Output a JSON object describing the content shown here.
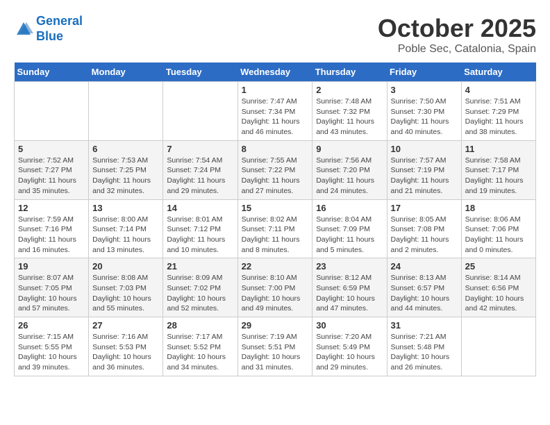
{
  "header": {
    "logo_line1": "General",
    "logo_line2": "Blue",
    "month": "October 2025",
    "location": "Poble Sec, Catalonia, Spain"
  },
  "weekdays": [
    "Sunday",
    "Monday",
    "Tuesday",
    "Wednesday",
    "Thursday",
    "Friday",
    "Saturday"
  ],
  "weeks": [
    [
      {
        "day": "",
        "info": ""
      },
      {
        "day": "",
        "info": ""
      },
      {
        "day": "",
        "info": ""
      },
      {
        "day": "1",
        "info": "Sunrise: 7:47 AM\nSunset: 7:34 PM\nDaylight: 11 hours and 46 minutes."
      },
      {
        "day": "2",
        "info": "Sunrise: 7:48 AM\nSunset: 7:32 PM\nDaylight: 11 hours and 43 minutes."
      },
      {
        "day": "3",
        "info": "Sunrise: 7:50 AM\nSunset: 7:30 PM\nDaylight: 11 hours and 40 minutes."
      },
      {
        "day": "4",
        "info": "Sunrise: 7:51 AM\nSunset: 7:29 PM\nDaylight: 11 hours and 38 minutes."
      }
    ],
    [
      {
        "day": "5",
        "info": "Sunrise: 7:52 AM\nSunset: 7:27 PM\nDaylight: 11 hours and 35 minutes."
      },
      {
        "day": "6",
        "info": "Sunrise: 7:53 AM\nSunset: 7:25 PM\nDaylight: 11 hours and 32 minutes."
      },
      {
        "day": "7",
        "info": "Sunrise: 7:54 AM\nSunset: 7:24 PM\nDaylight: 11 hours and 29 minutes."
      },
      {
        "day": "8",
        "info": "Sunrise: 7:55 AM\nSunset: 7:22 PM\nDaylight: 11 hours and 27 minutes."
      },
      {
        "day": "9",
        "info": "Sunrise: 7:56 AM\nSunset: 7:20 PM\nDaylight: 11 hours and 24 minutes."
      },
      {
        "day": "10",
        "info": "Sunrise: 7:57 AM\nSunset: 7:19 PM\nDaylight: 11 hours and 21 minutes."
      },
      {
        "day": "11",
        "info": "Sunrise: 7:58 AM\nSunset: 7:17 PM\nDaylight: 11 hours and 19 minutes."
      }
    ],
    [
      {
        "day": "12",
        "info": "Sunrise: 7:59 AM\nSunset: 7:16 PM\nDaylight: 11 hours and 16 minutes."
      },
      {
        "day": "13",
        "info": "Sunrise: 8:00 AM\nSunset: 7:14 PM\nDaylight: 11 hours and 13 minutes."
      },
      {
        "day": "14",
        "info": "Sunrise: 8:01 AM\nSunset: 7:12 PM\nDaylight: 11 hours and 10 minutes."
      },
      {
        "day": "15",
        "info": "Sunrise: 8:02 AM\nSunset: 7:11 PM\nDaylight: 11 hours and 8 minutes."
      },
      {
        "day": "16",
        "info": "Sunrise: 8:04 AM\nSunset: 7:09 PM\nDaylight: 11 hours and 5 minutes."
      },
      {
        "day": "17",
        "info": "Sunrise: 8:05 AM\nSunset: 7:08 PM\nDaylight: 11 hours and 2 minutes."
      },
      {
        "day": "18",
        "info": "Sunrise: 8:06 AM\nSunset: 7:06 PM\nDaylight: 11 hours and 0 minutes."
      }
    ],
    [
      {
        "day": "19",
        "info": "Sunrise: 8:07 AM\nSunset: 7:05 PM\nDaylight: 10 hours and 57 minutes."
      },
      {
        "day": "20",
        "info": "Sunrise: 8:08 AM\nSunset: 7:03 PM\nDaylight: 10 hours and 55 minutes."
      },
      {
        "day": "21",
        "info": "Sunrise: 8:09 AM\nSunset: 7:02 PM\nDaylight: 10 hours and 52 minutes."
      },
      {
        "day": "22",
        "info": "Sunrise: 8:10 AM\nSunset: 7:00 PM\nDaylight: 10 hours and 49 minutes."
      },
      {
        "day": "23",
        "info": "Sunrise: 8:12 AM\nSunset: 6:59 PM\nDaylight: 10 hours and 47 minutes."
      },
      {
        "day": "24",
        "info": "Sunrise: 8:13 AM\nSunset: 6:57 PM\nDaylight: 10 hours and 44 minutes."
      },
      {
        "day": "25",
        "info": "Sunrise: 8:14 AM\nSunset: 6:56 PM\nDaylight: 10 hours and 42 minutes."
      }
    ],
    [
      {
        "day": "26",
        "info": "Sunrise: 7:15 AM\nSunset: 5:55 PM\nDaylight: 10 hours and 39 minutes."
      },
      {
        "day": "27",
        "info": "Sunrise: 7:16 AM\nSunset: 5:53 PM\nDaylight: 10 hours and 36 minutes."
      },
      {
        "day": "28",
        "info": "Sunrise: 7:17 AM\nSunset: 5:52 PM\nDaylight: 10 hours and 34 minutes."
      },
      {
        "day": "29",
        "info": "Sunrise: 7:19 AM\nSunset: 5:51 PM\nDaylight: 10 hours and 31 minutes."
      },
      {
        "day": "30",
        "info": "Sunrise: 7:20 AM\nSunset: 5:49 PM\nDaylight: 10 hours and 29 minutes."
      },
      {
        "day": "31",
        "info": "Sunrise: 7:21 AM\nSunset: 5:48 PM\nDaylight: 10 hours and 26 minutes."
      },
      {
        "day": "",
        "info": ""
      }
    ]
  ]
}
